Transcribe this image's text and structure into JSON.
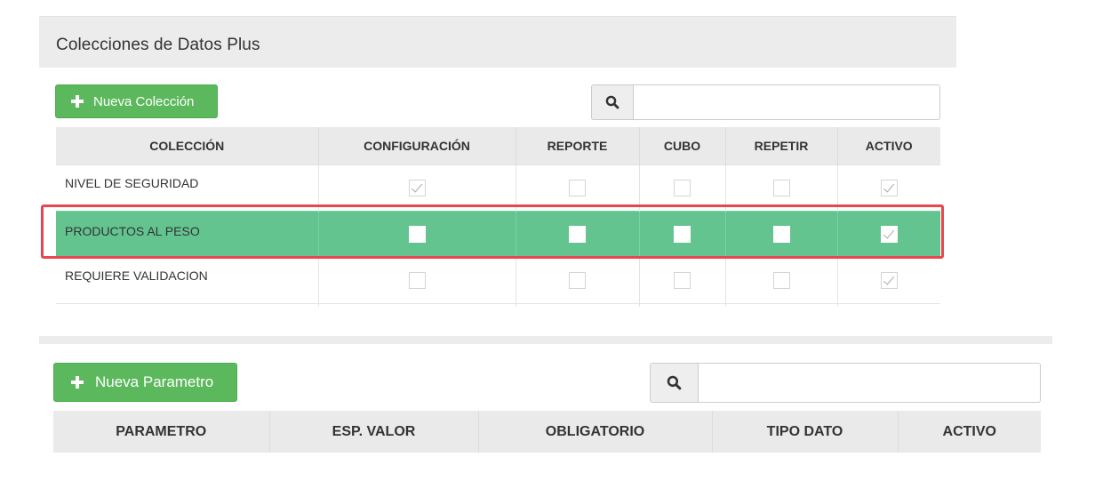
{
  "panel1": {
    "title": "Colecciones de Datos Plus",
    "new_button_label": "Nueva Colección",
    "search": {
      "value": "",
      "placeholder": ""
    },
    "columns": [
      "COLECCIÓN",
      "CONFIGURACIÓN",
      "REPORTE",
      "CUBO",
      "REPETIR",
      "ACTIVO"
    ],
    "rows": [
      {
        "name": "NIVEL DE SEGURIDAD",
        "configuracion": true,
        "reporte": false,
        "cubo": false,
        "repetir": false,
        "activo": true,
        "selected": false
      },
      {
        "name": "PRODUCTOS AL PESO",
        "configuracion": false,
        "reporte": false,
        "cubo": false,
        "repetir": false,
        "activo": true,
        "selected": true
      },
      {
        "name": "REQUIERE VALIDACION",
        "configuracion": false,
        "reporte": false,
        "cubo": false,
        "repetir": false,
        "activo": true,
        "selected": false
      }
    ]
  },
  "panel2": {
    "new_button_label": "Nueva Parametro",
    "search": {
      "value": "",
      "placeholder": ""
    },
    "columns": [
      "PARAMETRO",
      "ESP. VALOR",
      "OBLIGATORIO",
      "TIPO DATO",
      "ACTIVO"
    ]
  },
  "colors": {
    "accent_green": "#5cb85c",
    "selected_row": "#63c490",
    "highlight_border": "#e8474e",
    "header_bg": "#eaeaea"
  },
  "icons": {
    "add": "plus-icon",
    "search": "search-icon",
    "checkbox": "checkbox-icon"
  }
}
